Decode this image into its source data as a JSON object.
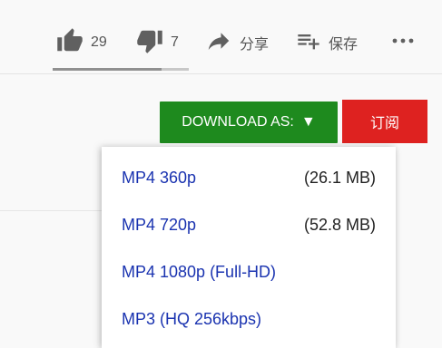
{
  "actions": {
    "like_count": "29",
    "dislike_count": "7",
    "share_label": "分享",
    "save_label": "保存",
    "like_ratio": 0.8
  },
  "download": {
    "label": "DOWNLOAD AS:",
    "caret": "▼",
    "color": "#1e8a1e"
  },
  "subscribe": {
    "label": "订阅",
    "color": "#de2220"
  },
  "menu": {
    "options": [
      {
        "format": "MP4 360p",
        "size": "(26.1 MB)"
      },
      {
        "format": "MP4 720p",
        "size": "(52.8 MB)"
      },
      {
        "format": "MP4 1080p (Full-HD)",
        "size": ""
      },
      {
        "format": "MP3 (HQ 256kbps)",
        "size": ""
      }
    ],
    "link_color": "#1a33b0"
  }
}
